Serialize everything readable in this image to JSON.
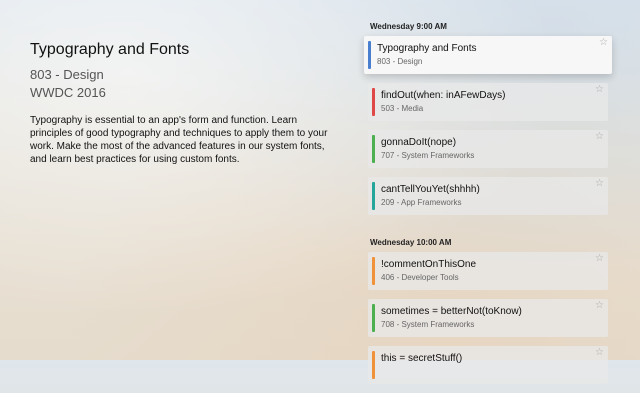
{
  "detail": {
    "title": "Typography and Fonts",
    "session": "803 - Design",
    "event": "WWDC 2016",
    "description": "Typography is essential to an app's form and function. Learn principles of good typography and techniques to apply them to your work. Make the most of the advanced features in our system fonts, and learn best practices for using custom fonts."
  },
  "schedule": {
    "sections": [
      {
        "header": "Wednesday 9:00 AM",
        "sessions": [
          {
            "title": "Typography and Fonts",
            "track": "803 - Design",
            "color": "#4a7fd0",
            "star": "☆",
            "selected": true
          },
          {
            "title": "findOut(when: inAFewDays)",
            "track": "503 - Media",
            "color": "#e04848",
            "star": "☆",
            "selected": false
          },
          {
            "title": "gonnaDoIt(nope)",
            "track": "707 - System Frameworks",
            "color": "#4caf50",
            "star": "☆",
            "selected": false
          },
          {
            "title": "cantTellYouYet(shhhh)",
            "track": "209 - App Frameworks",
            "color": "#26a69a",
            "star": "☆",
            "selected": false
          }
        ]
      },
      {
        "header": "Wednesday 10:00 AM",
        "sessions": [
          {
            "title": "!commentOnThisOne",
            "track": "406 - Developer Tools",
            "color": "#f0923a",
            "star": "☆",
            "selected": false
          },
          {
            "title": "sometimes = betterNot(toKnow)",
            "track": "708 - System Frameworks",
            "color": "#4caf50",
            "star": "☆",
            "selected": false
          },
          {
            "title": "this = secretStuff()",
            "track": "",
            "color": "#f0923a",
            "star": "☆",
            "selected": false
          }
        ]
      }
    ]
  }
}
